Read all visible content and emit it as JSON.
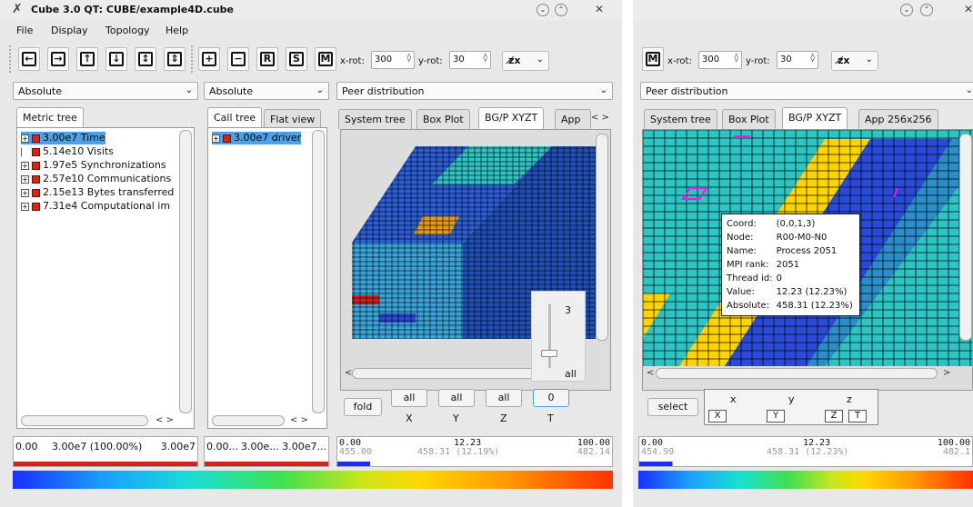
{
  "window_left": {
    "title": "Cube 3.0 QT: CUBE/example4D.cube",
    "menu": [
      "File",
      "Display",
      "Topology",
      "Help"
    ],
    "toolbar": {
      "buttons": [
        "arrow-left",
        "arrow-right",
        "arrow-up",
        "arrow-down",
        "expand-vertical",
        "collapse-vertical",
        "plus",
        "minus",
        "R",
        "S",
        "M"
      ],
      "xrot_label": "x-rot:",
      "xrot_value": "300",
      "yrot_label": "y-rot:",
      "yrot_value": "30"
    },
    "metric_combo": "Absolute",
    "call_combo": "Absolute",
    "system_combo": "Peer distribution",
    "metric_tabs": [
      "Metric tree"
    ],
    "call_tabs": [
      "Call tree",
      "Flat view"
    ],
    "system_tabs": [
      "System tree",
      "Box Plot",
      "BG/P XYZT",
      "App"
    ],
    "metric_items": [
      {
        "value": "3.00e7",
        "label": "Time",
        "selected": true,
        "expandable": true
      },
      {
        "value": "5.14e10",
        "label": "Visits",
        "selected": false,
        "expandable": false
      },
      {
        "value": "1.97e5",
        "label": "Synchronizations",
        "selected": false,
        "expandable": true
      },
      {
        "value": "2.57e10",
        "label": "Communications",
        "selected": false,
        "expandable": true
      },
      {
        "value": "2.15e13",
        "label": "Bytes transferred",
        "selected": false,
        "expandable": true
      },
      {
        "value": "7.31e4",
        "label": "Computational im",
        "selected": false,
        "expandable": true
      }
    ],
    "call_items": [
      {
        "value": "3.00e7",
        "label": "driver"
      }
    ],
    "slider_value": "3",
    "slider_bottom": "all",
    "fold_label": "fold",
    "dim_buttons": [
      "all",
      "all",
      "all",
      "0"
    ],
    "dim_labels": [
      "X",
      "Y",
      "Z",
      "T"
    ],
    "metric_status": {
      "min": "0.00",
      "mid": "3.00e7 (100.00%)",
      "max": "3.00e7"
    },
    "call_status": {
      "min": "0.00...",
      "mid": "3.00e...",
      "max": "3.00e7..."
    },
    "system_status": {
      "min": "0.00",
      "min2": "455.00",
      "mid": "12.23",
      "mid2": "458.31 (12.19%)",
      "max": "100.00",
      "max2": "482.14"
    }
  },
  "window_right": {
    "toolbar": {
      "button": "M",
      "xrot_label": "x-rot:",
      "xrot_value": "300",
      "yrot_label": "y-rot:",
      "yrot_value": "30"
    },
    "combo": "Peer distribution",
    "tabs": [
      "System tree",
      "Box Plot",
      "BG/P XYZT",
      "App 256x256"
    ],
    "tooltip": [
      {
        "k": "Coord:",
        "v": "(0,0,1,3)"
      },
      {
        "k": "Node:",
        "v": "R00-M0-N0"
      },
      {
        "k": "Name:",
        "v": "Process 2051"
      },
      {
        "k": "MPI rank:",
        "v": "2051"
      },
      {
        "k": "Thread id:",
        "v": "0"
      },
      {
        "k": "Value:",
        "v": "12.23 (12.23%)"
      },
      {
        "k": "Absolute:",
        "v": "458.31 (12.23%)"
      }
    ],
    "select_label": "select",
    "axis_headers": [
      "x",
      "y",
      "z"
    ],
    "axis_checks": [
      "X",
      "Y",
      "Z",
      "T"
    ],
    "status": {
      "min": "0.00",
      "min2": "454.99",
      "mid": "12.23",
      "mid2": "458.31 (12.23%)",
      "max": "100.00",
      "max2": "482.1"
    }
  },
  "colors": {
    "selection": "#4aa3e8",
    "cube_blue": "#2a4bd7",
    "cube_cyan": "#2ec4c4",
    "cube_yellow": "#ffd400",
    "cube_red": "#d62020",
    "highlight": "#e020e0"
  }
}
